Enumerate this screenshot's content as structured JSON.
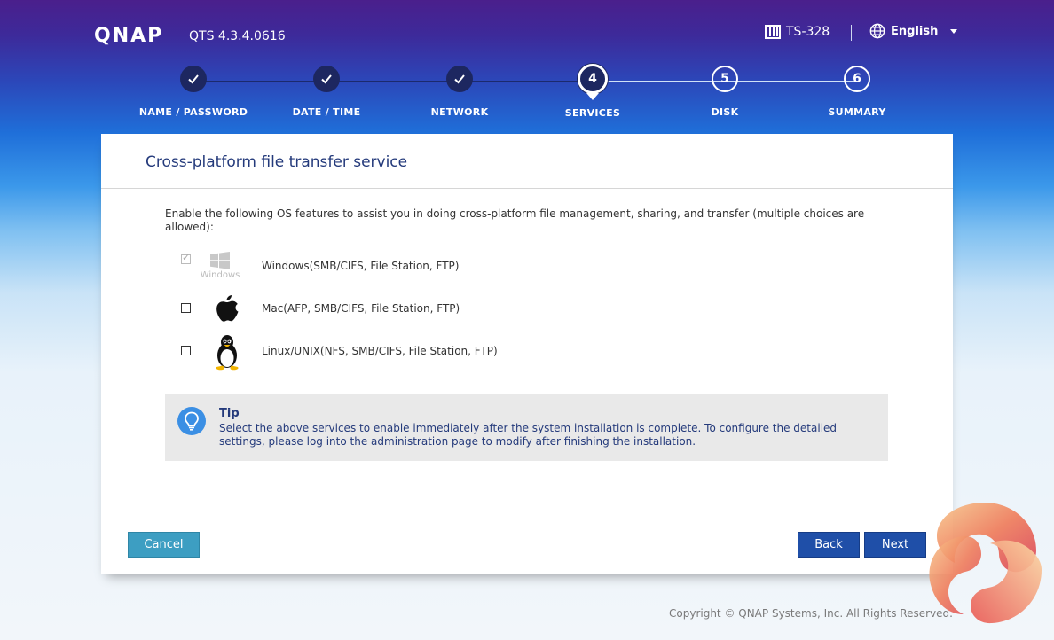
{
  "header": {
    "logo": "QNAP",
    "version": "QTS 4.3.4.0616",
    "device_name": "TS-328",
    "language": "English"
  },
  "wizard": {
    "steps": [
      {
        "number": "1",
        "label": "NAME / PASSWORD",
        "state": "done"
      },
      {
        "number": "2",
        "label": "DATE / TIME",
        "state": "done"
      },
      {
        "number": "3",
        "label": "NETWORK",
        "state": "done"
      },
      {
        "number": "4",
        "label": "SERVICES",
        "state": "current"
      },
      {
        "number": "5",
        "label": "DISK",
        "state": "pending"
      },
      {
        "number": "6",
        "label": "SUMMARY",
        "state": "pending"
      }
    ]
  },
  "panel": {
    "title": "Cross-platform file transfer service",
    "intro": "Enable the following OS features to assist you in doing cross-platform file management, sharing, and transfer (multiple choices are allowed):",
    "options": [
      {
        "label": "Windows(SMB/CIFS, File Station, FTP)",
        "icon": "windows-icon",
        "icon_caption": "Windows",
        "checked": true,
        "disabled": true
      },
      {
        "label": "Mac(AFP, SMB/CIFS, File Station, FTP)",
        "icon": "apple-icon",
        "checked": false,
        "disabled": false
      },
      {
        "label": "Linux/UNIX(NFS, SMB/CIFS, File Station, FTP)",
        "icon": "tux-icon",
        "checked": false,
        "disabled": false
      }
    ],
    "tip": {
      "title": "Tip",
      "text": "Select the above services to enable immediately after the system installation is complete. To configure the detailed settings, please log into the administration page to modify after finishing the installation."
    },
    "buttons": {
      "cancel": "Cancel",
      "back": "Back",
      "next": "Next"
    }
  },
  "footer": {
    "copyright": "Copyright © QNAP Systems, Inc. All Rights Reserved."
  },
  "colors": {
    "header_top": "#4a1f8c",
    "accent_navy": "#1d2760",
    "primary_button": "#1f4fa8",
    "cancel_button": "#3d9ec2",
    "title_text": "#243a7b"
  }
}
